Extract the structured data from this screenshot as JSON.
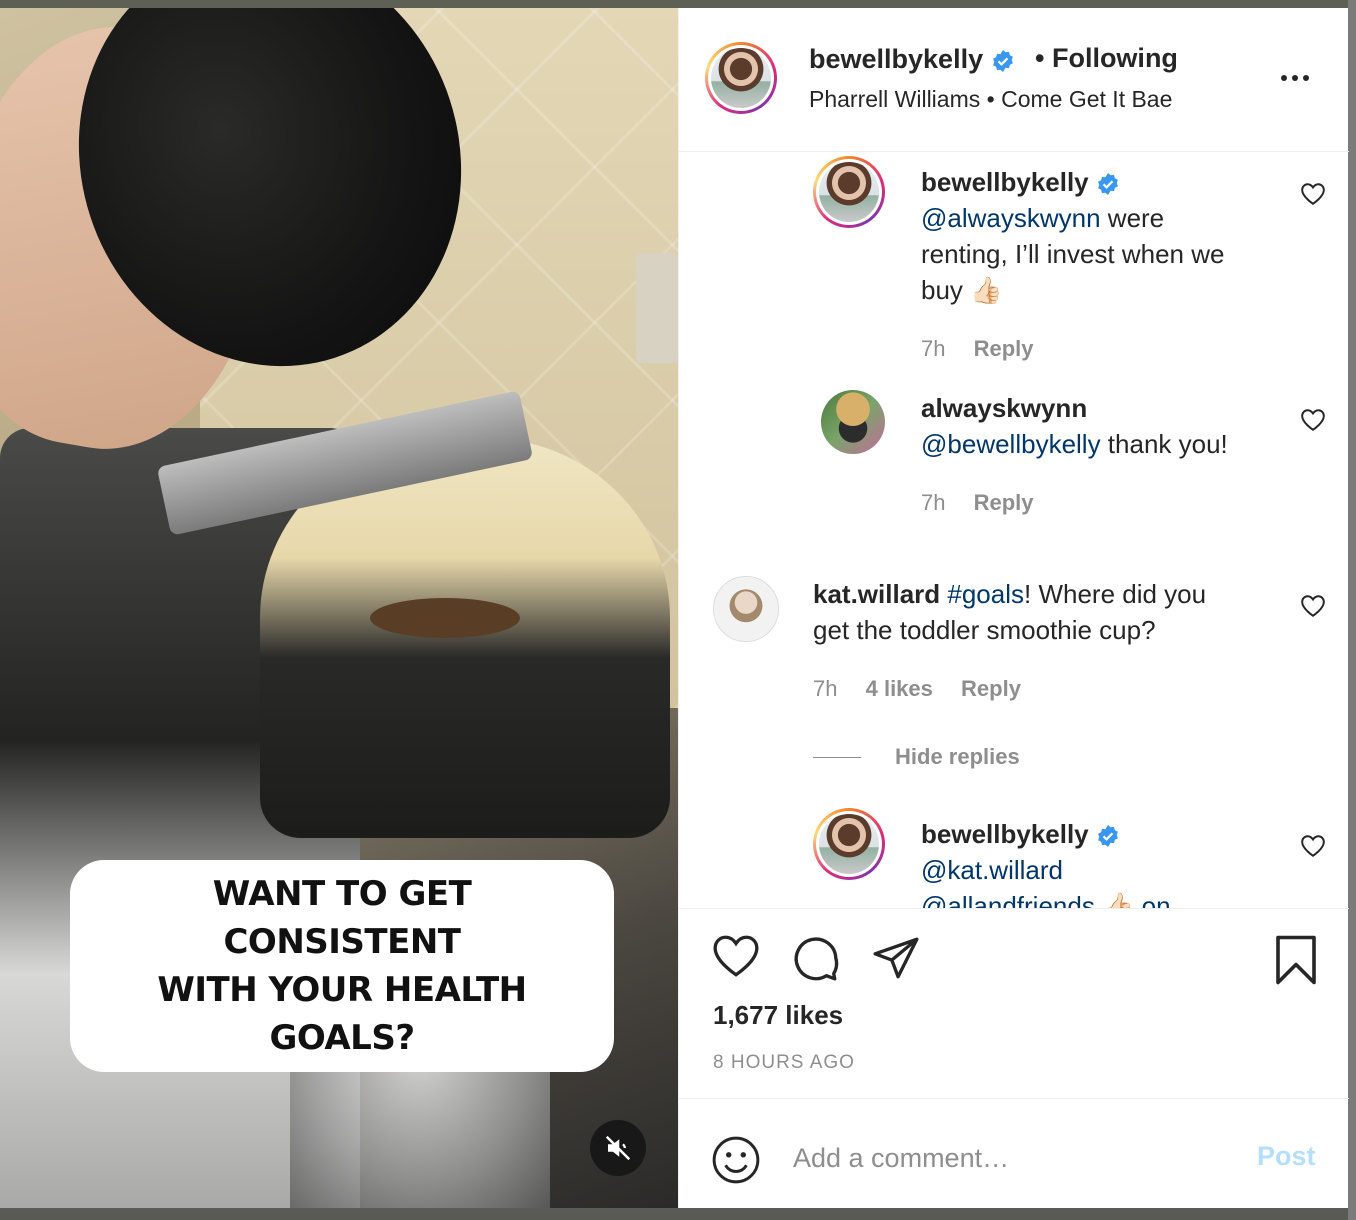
{
  "post": {
    "username": "bewellbykelly",
    "follow_status": "• Following",
    "music_artist": "Pharrell Williams",
    "music_separator": "•",
    "music_title": "Come Get It Bae",
    "video_caption_line1": "WANT TO GET CONSISTENT",
    "video_caption_line2": "WITH YOUR HEALTH GOALS?"
  },
  "comments": [
    {
      "username": "bewellbykelly",
      "verified": true,
      "mention": "@alwayskwynn",
      "text_line1": " were",
      "text_line2": "renting, I’ll invest when we",
      "text_line3": "buy 👍🏻",
      "time": "7h",
      "reply_label": "Reply"
    },
    {
      "username": "alwayskwynn",
      "mention": "@bewellbykelly",
      "text": " thank you!",
      "time": "7h",
      "reply_label": "Reply"
    },
    {
      "username": "kat.willard",
      "hashtag": "#goals",
      "text_line1": "! Where did you",
      "text_line2": "get the toddler smoothie cup?",
      "time": "7h",
      "likes": "4 likes",
      "reply_label": "Reply",
      "hide_replies": "Hide replies"
    },
    {
      "username": "bewellbykelly",
      "verified": true,
      "mention": "@kat.willard",
      "text_line2": "@allandfriends 👍🏻 on"
    }
  ],
  "stats": {
    "likes": "1,677 likes",
    "time_ago": "8 HOURS AGO"
  },
  "comment_box": {
    "placeholder": "Add a comment…",
    "post_label": "Post"
  },
  "colors": {
    "verified_blue": "#3897f0",
    "mention_blue": "#00376b",
    "meta_gray": "#8e8e8e",
    "post_disabled": "#b2dffc"
  }
}
